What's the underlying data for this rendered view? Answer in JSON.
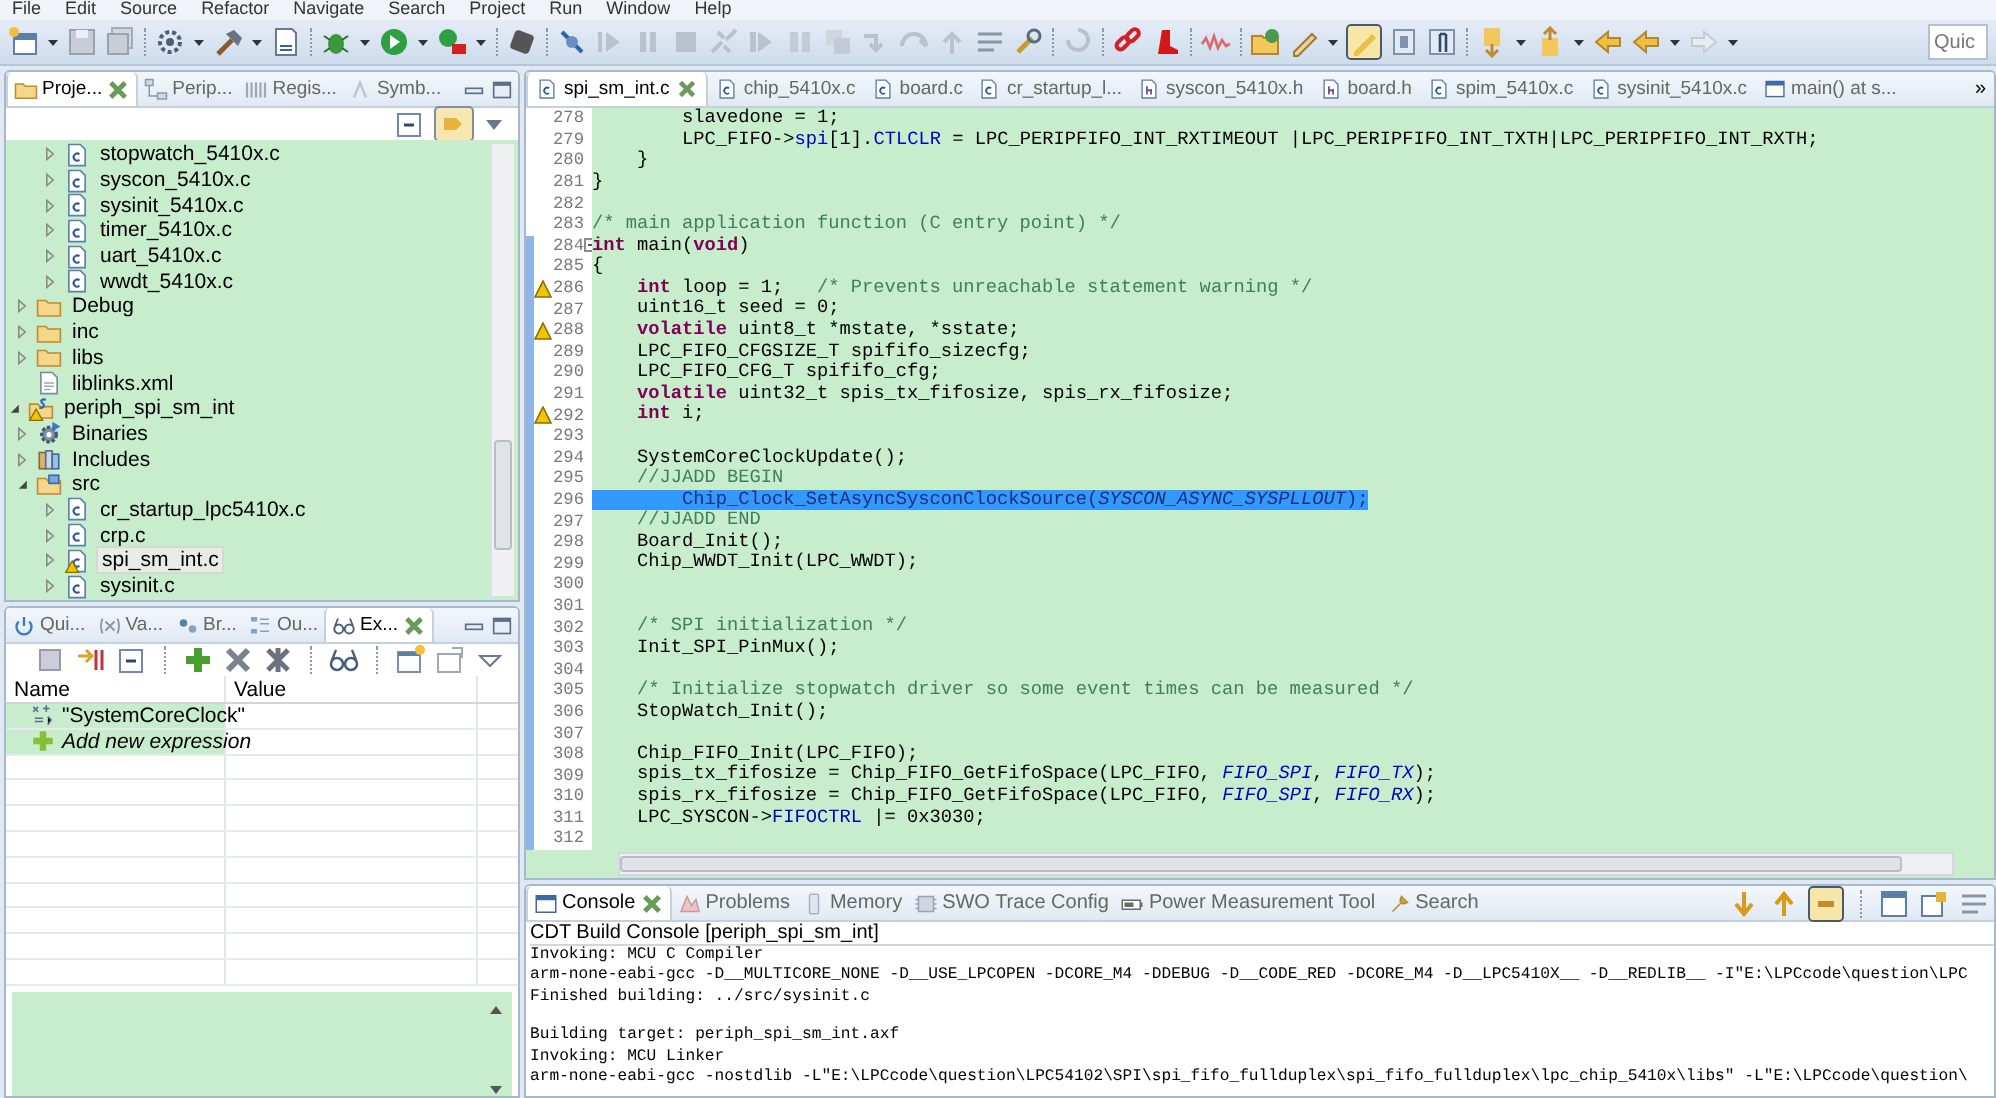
{
  "menu": [
    "File",
    "Edit",
    "Source",
    "Refactor",
    "Navigate",
    "Search",
    "Project",
    "Run",
    "Window",
    "Help"
  ],
  "quick_access": {
    "placeholder": "Quic"
  },
  "left_top": {
    "tabs": [
      {
        "label": "Proje...",
        "kind": "project",
        "selected": true
      },
      {
        "label": "Perip...",
        "kind": "peripherals",
        "selected": false
      },
      {
        "label": "Regis...",
        "kind": "registers",
        "selected": false
      },
      {
        "label": "Symb...",
        "kind": "symbols",
        "selected": false
      }
    ],
    "tree": [
      {
        "children": [
          {
            "children": [
              {
                "label": "stopwatch_5410x.c",
                "kind": "c_file",
                "expanded": false,
                "warning": false,
                "selected": false
              },
              {
                "label": "syscon_5410x.c",
                "kind": "c_file",
                "expanded": false,
                "warning": false,
                "selected": false
              },
              {
                "label": "sysinit_5410x.c",
                "kind": "c_file",
                "expanded": false,
                "warning": false,
                "selected": false
              },
              {
                "label": "timer_5410x.c",
                "kind": "c_file",
                "expanded": false,
                "warning": false,
                "selected": false
              },
              {
                "label": "uart_5410x.c",
                "kind": "c_file",
                "expanded": false,
                "warning": false,
                "selected": false
              },
              {
                "label": "wwdt_5410x.c",
                "kind": "c_file",
                "expanded": false,
                "warning": false,
                "selected": false
              }
            ]
          },
          {
            "label": "Debug",
            "kind": "folder",
            "expanded": false,
            "warning": false,
            "selected": false
          },
          {
            "label": "inc",
            "kind": "folder",
            "expanded": false,
            "warning": false,
            "selected": false
          },
          {
            "label": "libs",
            "kind": "folder",
            "expanded": false,
            "warning": false,
            "selected": false
          },
          {
            "label": "liblinks.xml",
            "kind": "xml_file",
            "warning": false,
            "selected": false
          }
        ]
      },
      {
        "label": "periph_spi_sm_int",
        "kind": "project",
        "expanded": true,
        "warning": true,
        "selected": false,
        "children": [
          {
            "label": "Binaries",
            "kind": "binaries",
            "expanded": false,
            "warning": false,
            "selected": false
          },
          {
            "label": "Includes",
            "kind": "includes",
            "expanded": false,
            "warning": false,
            "selected": false
          },
          {
            "label": "src",
            "kind": "source_folder",
            "expanded": true,
            "warning": false,
            "selected": false,
            "children": [
              {
                "label": "cr_startup_lpc5410x.c",
                "kind": "c_file",
                "expanded": false,
                "warning": false,
                "selected": false
              },
              {
                "label": "crp.c",
                "kind": "c_file",
                "expanded": false,
                "warning": false,
                "selected": false
              },
              {
                "label": "spi_sm_int.c",
                "kind": "c_file",
                "expanded": false,
                "warning": true,
                "selected": true
              },
              {
                "label": "sysinit.c",
                "kind": "c_file",
                "expanded": false,
                "warning": false,
                "selected": false
              }
            ]
          }
        ]
      }
    ]
  },
  "left_bottom": {
    "tabs": [
      {
        "label": "Qui...",
        "kind": "quickstart",
        "selected": false
      },
      {
        "label": "Va...",
        "kind": "variables",
        "selected": false
      },
      {
        "label": "Br...",
        "kind": "breakpoints",
        "selected": false
      },
      {
        "label": "Ou...",
        "kind": "outline",
        "selected": false
      },
      {
        "label": "Ex...",
        "kind": "expressions",
        "selected": true
      }
    ],
    "table": {
      "columns": [
        "Name",
        "Value"
      ],
      "rows": [
        {
          "kind": "expression",
          "name": "\"SystemCoreClock\""
        },
        {
          "kind": "add",
          "name": "Add new expression"
        }
      ]
    }
  },
  "editor": {
    "tabs": [
      {
        "label": "spi_sm_int.c",
        "kind": "c",
        "selected": true
      },
      {
        "label": "chip_5410x.c",
        "kind": "c",
        "selected": false
      },
      {
        "label": "board.c",
        "kind": "c",
        "selected": false
      },
      {
        "label": "cr_startup_l...",
        "kind": "c",
        "selected": false
      },
      {
        "label": "syscon_5410x.h",
        "kind": "h",
        "selected": false
      },
      {
        "label": "board.h",
        "kind": "h",
        "selected": false
      },
      {
        "label": "spim_5410x.c",
        "kind": "c",
        "selected": false
      },
      {
        "label": "sysinit_5410x.c",
        "kind": "c",
        "selected": false
      },
      {
        "label": "main() at s...",
        "kind": "stack",
        "selected": false
      }
    ],
    "overflow": "»",
    "lines": [
      {
        "number": "278",
        "changed": false,
        "warning": false,
        "selected": false,
        "fold": false,
        "segments": [
          {
            "kind": "plain",
            "text": "        slavedone = 1;"
          }
        ]
      },
      {
        "number": "279",
        "changed": false,
        "warning": false,
        "selected": false,
        "fold": false,
        "segments": [
          {
            "kind": "plain",
            "text": "        LPC_FIFO->"
          },
          {
            "kind": "field",
            "text": "spi"
          },
          {
            "kind": "plain",
            "text": "[1]."
          },
          {
            "kind": "field",
            "text": "CTLCLR"
          },
          {
            "kind": "plain",
            "text": " = LPC_PERIPFIFO_INT_RXTIMEOUT |LPC_PERIPFIFO_INT_TXTH|LPC_PERIPFIFO_INT_RXTH;"
          }
        ]
      },
      {
        "number": "280",
        "changed": false,
        "warning": false,
        "selected": false,
        "fold": false,
        "segments": [
          {
            "kind": "plain",
            "text": "    }"
          }
        ]
      },
      {
        "number": "281",
        "changed": false,
        "warning": false,
        "selected": false,
        "fold": false,
        "segments": [
          {
            "kind": "plain",
            "text": "}"
          }
        ]
      },
      {
        "number": "282",
        "changed": false,
        "warning": false,
        "selected": false,
        "fold": false
      },
      {
        "number": "283",
        "changed": false,
        "warning": false,
        "selected": false,
        "fold": false,
        "segments": [
          {
            "kind": "comment",
            "text": "/* main application function (C entry point) */"
          }
        ]
      },
      {
        "number": "284",
        "changed": true,
        "warning": false,
        "selected": false,
        "fold": true,
        "segments": [
          {
            "kind": "keyword",
            "text": "int"
          },
          {
            "kind": "plain",
            "text": " main("
          },
          {
            "kind": "keyword",
            "text": "void"
          },
          {
            "kind": "plain",
            "text": ")"
          }
        ]
      },
      {
        "number": "285",
        "changed": true,
        "warning": false,
        "selected": false,
        "fold": false,
        "segments": [
          {
            "kind": "plain",
            "text": "{"
          }
        ]
      },
      {
        "number": "286",
        "changed": true,
        "warning": true,
        "selected": false,
        "fold": false,
        "segments": [
          {
            "kind": "keyword",
            "text": "    int"
          },
          {
            "kind": "plain",
            "text": " loop = 1;   "
          },
          {
            "kind": "comment",
            "text": "/* Prevents unreachable statement warning */"
          }
        ]
      },
      {
        "number": "287",
        "changed": true,
        "warning": false,
        "selected": false,
        "fold": false,
        "segments": [
          {
            "kind": "plain",
            "text": "    uint16_t seed = 0;"
          }
        ]
      },
      {
        "number": "288",
        "changed": true,
        "warning": true,
        "selected": false,
        "fold": false,
        "segments": [
          {
            "kind": "keyword",
            "text": "    volatile"
          },
          {
            "kind": "plain",
            "text": " uint8_t *mstate, *sstate;"
          }
        ]
      },
      {
        "number": "289",
        "changed": true,
        "warning": false,
        "selected": false,
        "fold": false,
        "segments": [
          {
            "kind": "plain",
            "text": "    LPC_FIFO_CFGSIZE_T spififo_sizecfg;"
          }
        ]
      },
      {
        "number": "290",
        "changed": true,
        "warning": false,
        "selected": false,
        "fold": false,
        "segments": [
          {
            "kind": "plain",
            "text": "    LPC_FIFO_CFG_T spififo_cfg;"
          }
        ]
      },
      {
        "number": "291",
        "changed": true,
        "warning": false,
        "selected": false,
        "fold": false,
        "segments": [
          {
            "kind": "keyword",
            "text": "    volatile"
          },
          {
            "kind": "plain",
            "text": " uint32_t spis_tx_fifosize, spis_rx_fifosize;"
          }
        ]
      },
      {
        "number": "292",
        "changed": true,
        "warning": true,
        "selected": false,
        "fold": false,
        "segments": [
          {
            "kind": "keyword",
            "text": "    int"
          },
          {
            "kind": "plain",
            "text": " i;"
          }
        ]
      },
      {
        "number": "293",
        "changed": true,
        "warning": false,
        "selected": false,
        "fold": false
      },
      {
        "number": "294",
        "changed": true,
        "warning": false,
        "selected": false,
        "fold": false,
        "segments": [
          {
            "kind": "plain",
            "text": "    SystemCoreClockUpdate();"
          }
        ]
      },
      {
        "number": "295",
        "changed": true,
        "warning": false,
        "selected": false,
        "fold": false,
        "segments": [
          {
            "kind": "comment",
            "text": "    //JJADD BEGIN"
          }
        ]
      },
      {
        "number": "296",
        "changed": true,
        "warning": false,
        "selected": true,
        "fold": false,
        "segments": [
          {
            "kind": "plain",
            "text": "        Chip_Clock_SetAsyncSysconClockSource("
          },
          {
            "kind": "constant",
            "text": "SYSCON_ASYNC_SYSPLLOUT"
          },
          {
            "kind": "plain",
            "text": ");"
          }
        ]
      },
      {
        "number": "297",
        "changed": true,
        "warning": false,
        "selected": false,
        "fold": false,
        "segments": [
          {
            "kind": "comment",
            "text": "    //JJADD END"
          }
        ]
      },
      {
        "number": "298",
        "changed": true,
        "warning": false,
        "selected": false,
        "fold": false,
        "segments": [
          {
            "kind": "plain",
            "text": "    Board_Init();"
          }
        ]
      },
      {
        "number": "299",
        "changed": true,
        "warning": false,
        "selected": false,
        "fold": false,
        "segments": [
          {
            "kind": "plain",
            "text": "    Chip_WWDT_Init(LPC_WWDT);"
          }
        ]
      },
      {
        "number": "300",
        "changed": true,
        "warning": false,
        "selected": false,
        "fold": false
      },
      {
        "number": "301",
        "changed": true,
        "warning": false,
        "selected": false,
        "fold": false
      },
      {
        "number": "302",
        "changed": true,
        "warning": false,
        "selected": false,
        "fold": false,
        "segments": [
          {
            "kind": "comment",
            "text": "    /* SPI initialization */"
          }
        ]
      },
      {
        "number": "303",
        "changed": true,
        "warning": false,
        "selected": false,
        "fold": false,
        "segments": [
          {
            "kind": "plain",
            "text": "    Init_SPI_PinMux();"
          }
        ]
      },
      {
        "number": "304",
        "changed": true,
        "warning": false,
        "selected": false,
        "fold": false
      },
      {
        "number": "305",
        "changed": true,
        "warning": false,
        "selected": false,
        "fold": false,
        "segments": [
          {
            "kind": "comment",
            "text": "    /* Initialize stopwatch driver so some event times can be measured */"
          }
        ]
      },
      {
        "number": "306",
        "changed": true,
        "warning": false,
        "selected": false,
        "fold": false,
        "segments": [
          {
            "kind": "plain",
            "text": "    StopWatch_Init();"
          }
        ]
      },
      {
        "number": "307",
        "changed": true,
        "warning": false,
        "selected": false,
        "fold": false
      },
      {
        "number": "308",
        "changed": true,
        "warning": false,
        "selected": false,
        "fold": false,
        "segments": [
          {
            "kind": "plain",
            "text": "    Chip_FIFO_Init(LPC_FIFO);"
          }
        ]
      },
      {
        "number": "309",
        "changed": true,
        "warning": false,
        "selected": false,
        "fold": false,
        "segments": [
          {
            "kind": "plain",
            "text": "    spis_tx_fifosize = Chip_FIFO_GetFifoSpace(LPC_FIFO, "
          },
          {
            "kind": "constant",
            "text": "FIFO_SPI"
          },
          {
            "kind": "plain",
            "text": ", "
          },
          {
            "kind": "constant",
            "text": "FIFO_TX"
          },
          {
            "kind": "plain",
            "text": ");"
          }
        ]
      },
      {
        "number": "310",
        "changed": true,
        "warning": false,
        "selected": false,
        "fold": false,
        "segments": [
          {
            "kind": "plain",
            "text": "    spis_rx_fifosize = Chip_FIFO_GetFifoSpace(LPC_FIFO, "
          },
          {
            "kind": "constant",
            "text": "FIFO_SPI"
          },
          {
            "kind": "plain",
            "text": ", "
          },
          {
            "kind": "constant",
            "text": "FIFO_RX"
          },
          {
            "kind": "plain",
            "text": ");"
          }
        ]
      },
      {
        "number": "311",
        "changed": true,
        "warning": false,
        "selected": false,
        "fold": false,
        "segments": [
          {
            "kind": "plain",
            "text": "    LPC_SYSCON->"
          },
          {
            "kind": "field",
            "text": "FIFOCTRL"
          },
          {
            "kind": "plain",
            "text": " |= 0x3030;"
          }
        ]
      },
      {
        "number": "312",
        "changed": true,
        "warning": false,
        "selected": false,
        "fold": false
      }
    ]
  },
  "console": {
    "tabs": [
      {
        "label": "Console",
        "kind": "console",
        "selected": true
      },
      {
        "label": "Problems",
        "kind": "problems",
        "selected": false
      },
      {
        "label": "Memory",
        "kind": "memory",
        "selected": false
      },
      {
        "label": "SWO Trace Config",
        "kind": "swo",
        "selected": false
      },
      {
        "label": "Power Measurement Tool",
        "kind": "power",
        "selected": false
      },
      {
        "label": "Search",
        "kind": "search",
        "selected": false
      }
    ],
    "title": "CDT Build Console [periph_spi_sm_int]",
    "blocks": [
      [
        "Invoking: MCU C Compiler",
        "arm-none-eabi-gcc -D__MULTICORE_NONE -D__USE_LPCOPEN -DCORE_M4 -DDEBUG -D__CODE_RED -DCORE_M4 -D__LPC5410X__ -D__REDLIB__ -I\"E:\\LPCcode\\question\\LPC",
        "Finished building: ../src/sysinit.c"
      ],
      [
        "Building target: periph_spi_sm_int.axf",
        "Invoking: MCU Linker",
        "arm-none-eabi-gcc -nostdlib -L\"E:\\LPCcode\\question\\LPC54102\\SPI\\spi_fifo_fullduplex\\spi_fifo_fullduplex\\lpc_chip_5410x\\libs\" -L\"E:\\LPCcode\\question\\"
      ]
    ]
  }
}
